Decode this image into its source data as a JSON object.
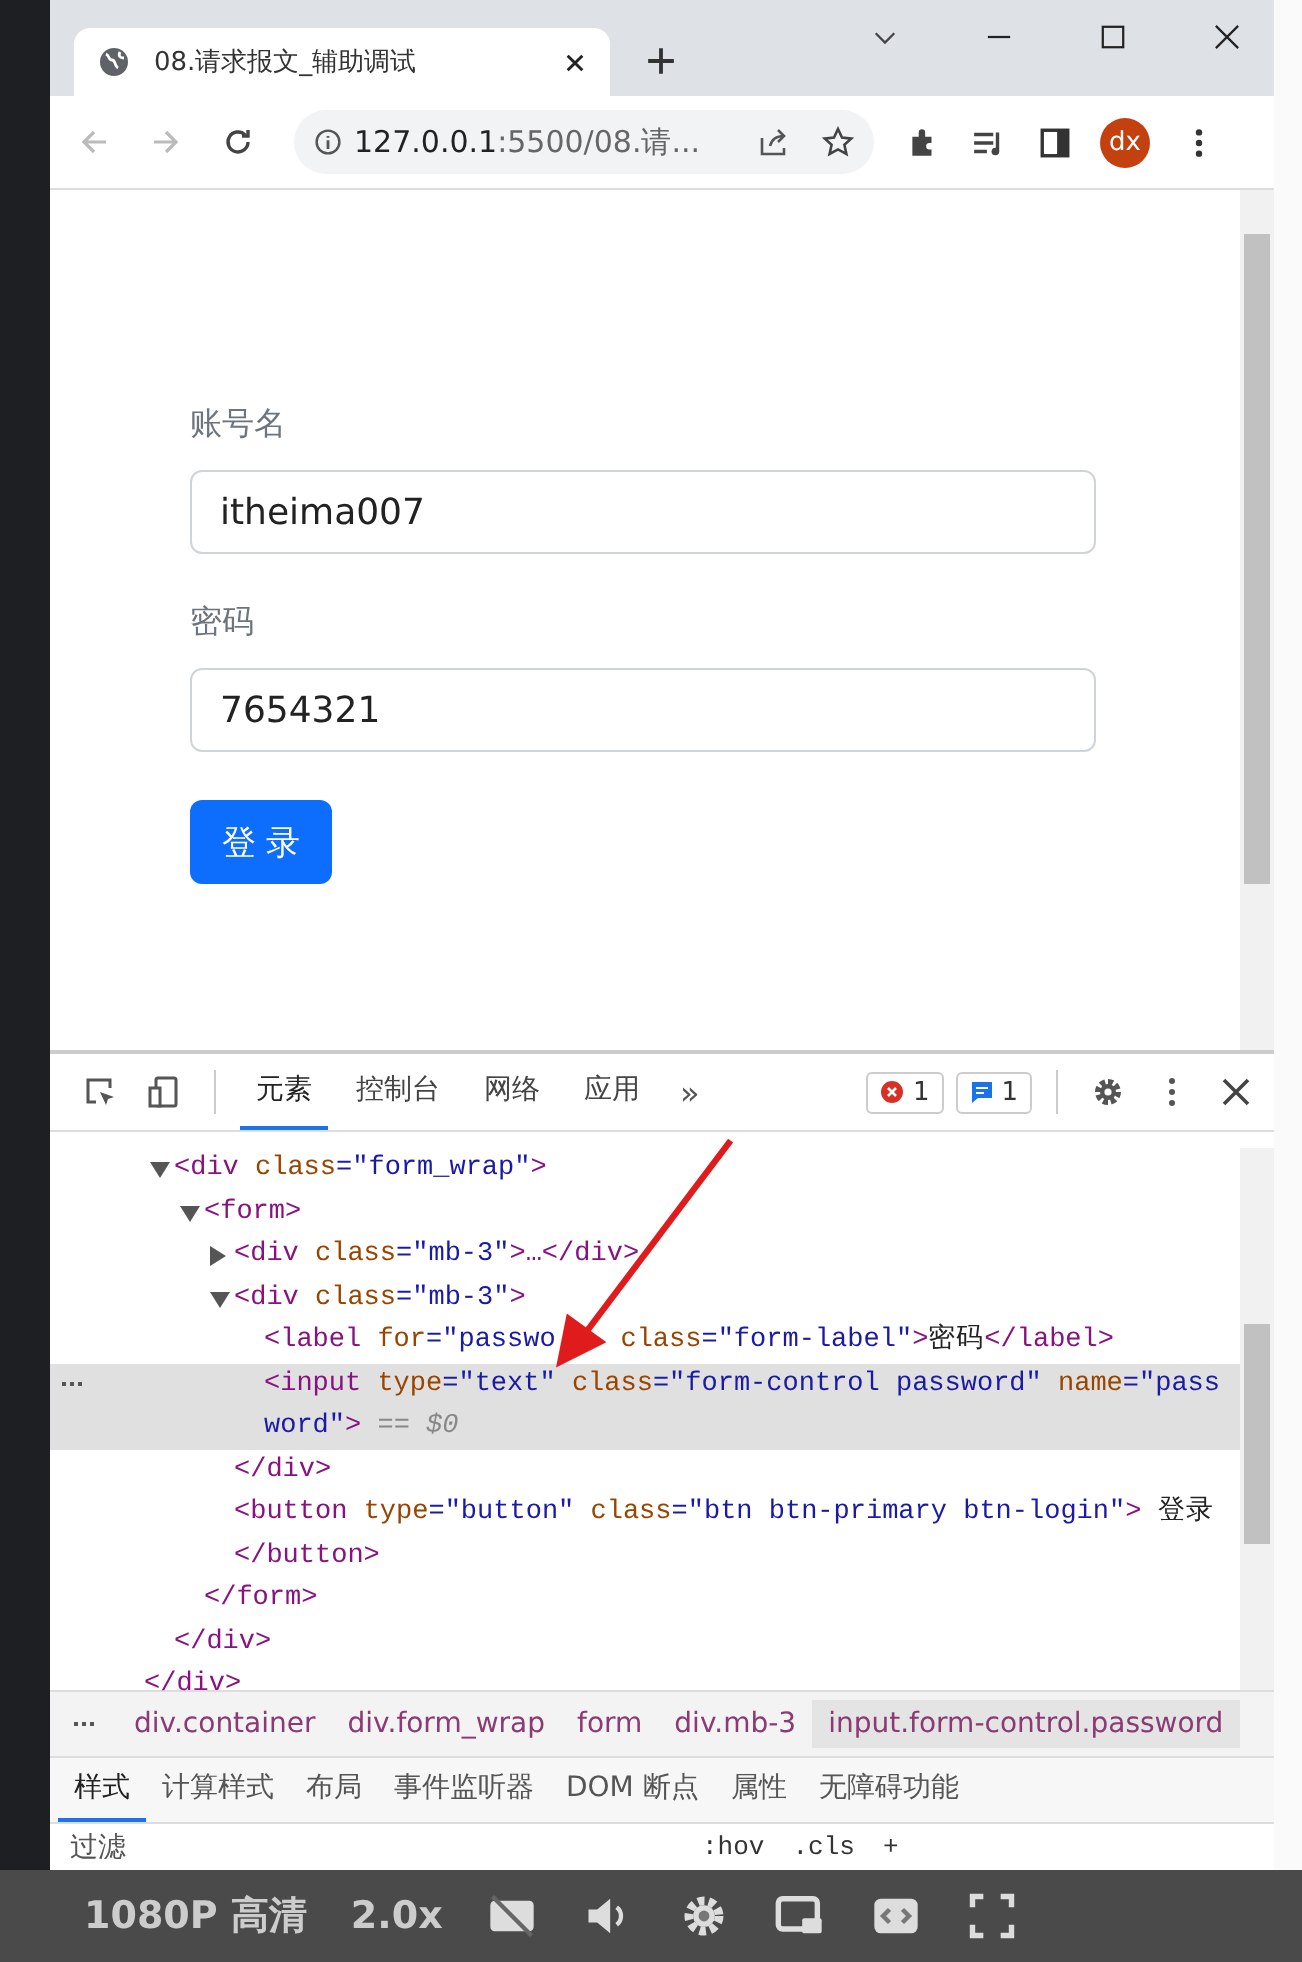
{
  "browser": {
    "tab": {
      "title": "08.请求报文_辅助调试",
      "selected": true
    },
    "address": {
      "host": "127.0.0.1",
      "rest": ":5500/08.请..."
    },
    "profile": "dx"
  },
  "page": {
    "fields": [
      {
        "label": "账号名",
        "value": "itheima007"
      },
      {
        "label": "密码",
        "value": "7654321"
      }
    ],
    "button": "登 录"
  },
  "devtools": {
    "tabs": [
      {
        "label": "元素",
        "selected": true
      },
      {
        "label": "控制台",
        "selected": false
      },
      {
        "label": "网络",
        "selected": false
      },
      {
        "label": "应用",
        "selected": false
      }
    ],
    "more": "»",
    "errors": "1",
    "messages": "1",
    "dom": [
      {
        "expanded": true,
        "selected": false,
        "tokens": [
          {
            "kind": "tag",
            "text": "<div"
          },
          {
            "kind": "attr",
            "text": " class"
          },
          {
            "kind": "value",
            "text": "=\"form_wrap\""
          },
          {
            "kind": "tag",
            "text": ">"
          }
        ],
        "closing": "</div>",
        "children": [
          {
            "expanded": true,
            "selected": false,
            "tokens": [
              {
                "kind": "tag",
                "text": "<form>"
              }
            ],
            "closing": "</form>",
            "children": [
              {
                "expanded": false,
                "selected": false,
                "tokens": [
                  {
                    "kind": "tag",
                    "text": "<div"
                  },
                  {
                    "kind": "attr",
                    "text": " class"
                  },
                  {
                    "kind": "value",
                    "text": "=\"mb-3\""
                  },
                  {
                    "kind": "tag",
                    "text": ">…</div>"
                  }
                ]
              },
              {
                "expanded": true,
                "selected": false,
                "tokens": [
                  {
                    "kind": "tag",
                    "text": "<div"
                  },
                  {
                    "kind": "attr",
                    "text": " class"
                  },
                  {
                    "kind": "value",
                    "text": "=\"mb-3\""
                  },
                  {
                    "kind": "tag",
                    "text": ">"
                  }
                ],
                "closing": "</div>",
                "children": [
                  {
                    "selected": false,
                    "tokens": [
                      {
                        "kind": "tag",
                        "text": "<label"
                      },
                      {
                        "kind": "attr",
                        "text": " for"
                      },
                      {
                        "kind": "value",
                        "text": "=\"passwo"
                      },
                      {
                        "kind": "gap"
                      },
                      {
                        "kind": "attr",
                        "text": " class"
                      },
                      {
                        "kind": "value",
                        "text": "=\"form-label\""
                      },
                      {
                        "kind": "tag",
                        "text": ">"
                      },
                      {
                        "kind": "text",
                        "text": "密码"
                      },
                      {
                        "kind": "tag",
                        "text": "</label>"
                      }
                    ]
                  },
                  {
                    "selected": true,
                    "tokens": [
                      {
                        "kind": "tag",
                        "text": "<input"
                      },
                      {
                        "kind": "attr",
                        "text": " type"
                      },
                      {
                        "kind": "value",
                        "text": "=\"text\""
                      },
                      {
                        "kind": "attr",
                        "text": " class"
                      },
                      {
                        "kind": "value",
                        "text": "=\"form-control password\""
                      },
                      {
                        "kind": "attr",
                        "text": " name"
                      },
                      {
                        "kind": "value",
                        "text": "=\"password\""
                      },
                      {
                        "kind": "tag",
                        "text": ">"
                      },
                      {
                        "kind": "hint",
                        "text": " == $0"
                      }
                    ]
                  }
                ]
              },
              {
                "selected": false,
                "tokens": [
                  {
                    "kind": "tag",
                    "text": "<button"
                  },
                  {
                    "kind": "attr",
                    "text": " type"
                  },
                  {
                    "kind": "value",
                    "text": "=\"button\""
                  },
                  {
                    "kind": "attr",
                    "text": " class"
                  },
                  {
                    "kind": "value",
                    "text": "=\"btn btn-primary btn-login\""
                  },
                  {
                    "kind": "tag",
                    "text": ">"
                  },
                  {
                    "kind": "text",
                    "text": " 登录 "
                  },
                  {
                    "kind": "tag",
                    "text": "</button>"
                  }
                ]
              }
            ]
          }
        ]
      }
    ],
    "outer_closing": "</div>",
    "breadcrumbs": [
      {
        "label": "div.container",
        "selected": false
      },
      {
        "label": "div.form_wrap",
        "selected": false
      },
      {
        "label": "form",
        "selected": false
      },
      {
        "label": "div.mb-3",
        "selected": false
      },
      {
        "label": "input.form-control.password",
        "selected": true
      }
    ],
    "style_tabs": [
      {
        "label": "样式",
        "selected": true
      },
      {
        "label": "计算样式",
        "selected": false
      },
      {
        "label": "布局",
        "selected": false
      },
      {
        "label": "事件监听器",
        "selected": false
      },
      {
        "label": "DOM 断点",
        "selected": false
      },
      {
        "label": "属性",
        "selected": false
      },
      {
        "label": "无障碍功能",
        "selected": false
      }
    ],
    "filter": {
      "placeholder": "过滤",
      "buttons": [
        ":hov",
        ".cls",
        "+"
      ]
    }
  },
  "player": {
    "quality": "1080P 高清",
    "speed": "2.0x"
  }
}
